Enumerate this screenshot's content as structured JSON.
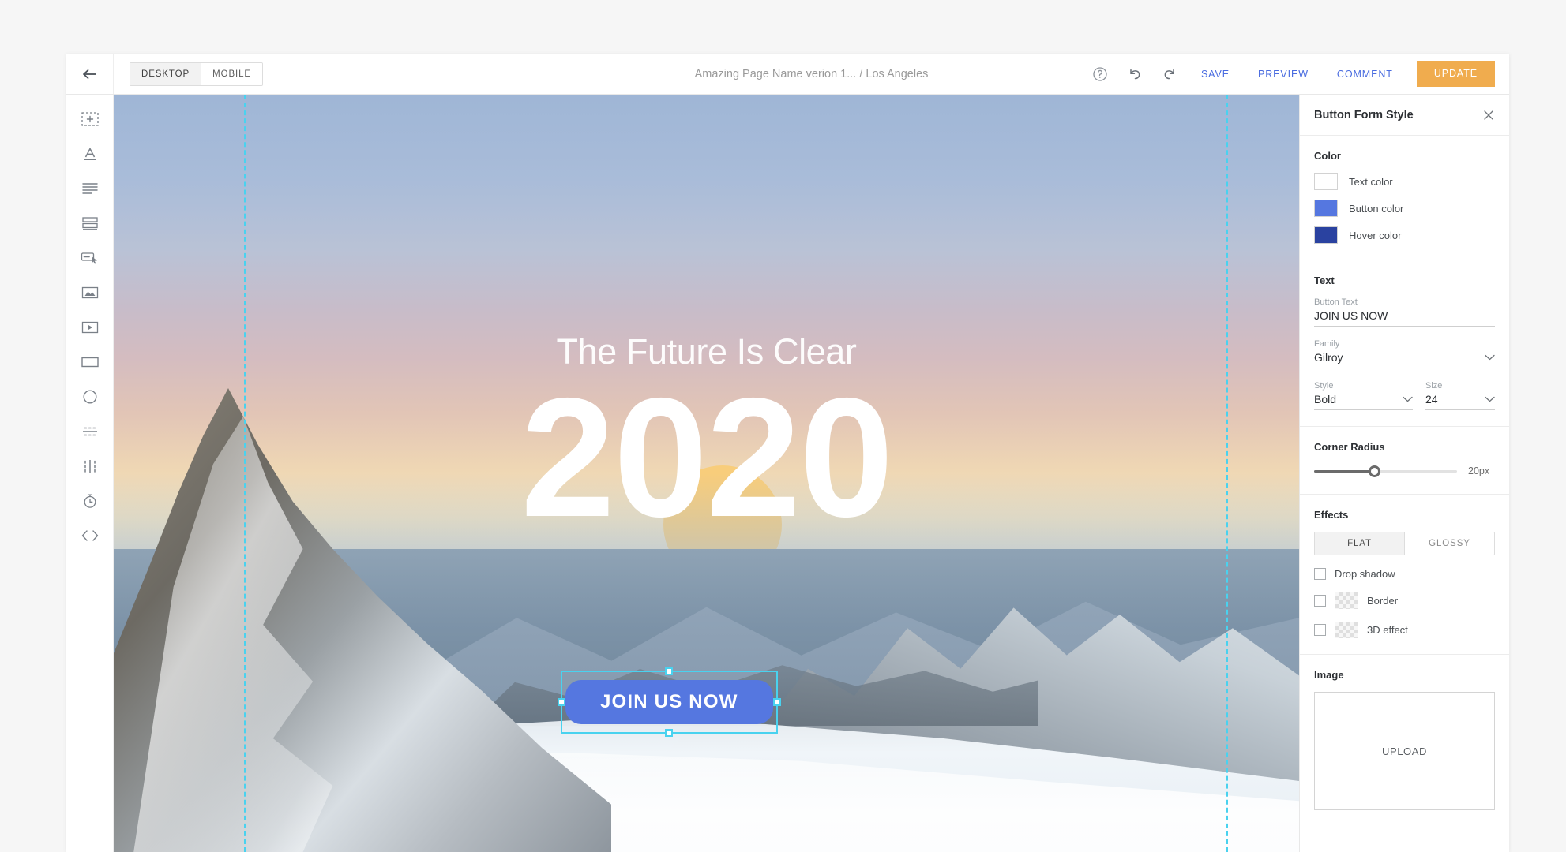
{
  "topbar": {
    "back_icon": "arrow-left-icon",
    "device_tabs": [
      {
        "label": "DESKTOP",
        "active": true
      },
      {
        "label": "MOBILE",
        "active": false
      }
    ],
    "page_title": "Amazing Page Name verion 1... / Los Angeles",
    "help_icon": "help-circle-icon",
    "undo_icon": "undo-icon",
    "redo_icon": "redo-icon",
    "save_label": "SAVE",
    "preview_label": "PREVIEW",
    "comment_label": "COMMENT",
    "update_label": "UPDATE",
    "link_color": "#4a6ce0",
    "update_color": "#f0ac4e"
  },
  "rail": {
    "items": [
      {
        "name": "add-section-icon"
      },
      {
        "name": "text-heading-icon"
      },
      {
        "name": "paragraph-icon"
      },
      {
        "name": "rows-icon"
      },
      {
        "name": "button-icon"
      },
      {
        "name": "image-icon"
      },
      {
        "name": "video-icon"
      },
      {
        "name": "rectangle-icon"
      },
      {
        "name": "circle-icon"
      },
      {
        "name": "horizontal-divider-icon"
      },
      {
        "name": "vertical-divider-icon"
      },
      {
        "name": "timer-icon"
      },
      {
        "name": "code-icon"
      }
    ]
  },
  "canvas": {
    "hero_subtitle": "The Future Is Clear",
    "hero_year": "2020",
    "cta_label": "JOIN US NOW",
    "cta_color": "#5577e0",
    "guide_color": "#49d2ef",
    "selection_color": "#49d2ef",
    "sun_color": "#f8cd7b"
  },
  "panel": {
    "title": "Button Form Style",
    "close_icon": "close-icon",
    "color_section": {
      "title": "Color",
      "swatches": [
        {
          "label": "Text color",
          "hex": "#ffffff"
        },
        {
          "label": "Button color",
          "hex": "#5577e0"
        },
        {
          "label": "Hover color",
          "hex": "#2a42a0"
        }
      ]
    },
    "text_section": {
      "title": "Text",
      "button_text_label": "Button Text",
      "button_text_value": "JOIN US NOW",
      "family_label": "Family",
      "family_value": "Gilroy",
      "style_label": "Style",
      "style_value": "Bold",
      "size_label": "Size",
      "size_value": "24"
    },
    "corner_section": {
      "title": "Corner Radius",
      "value": "20px",
      "percent": 42
    },
    "effects_section": {
      "title": "Effects",
      "tabs": [
        {
          "label": "FLAT",
          "active": true
        },
        {
          "label": "GLOSSY",
          "active": false
        }
      ],
      "checks": [
        {
          "label": "Drop shadow",
          "checked": false,
          "has_swatch": false
        },
        {
          "label": "Border",
          "checked": false,
          "has_swatch": true
        },
        {
          "label": "3D effect",
          "checked": false,
          "has_swatch": true
        }
      ]
    },
    "image_section": {
      "title": "Image",
      "upload_label": "UPLOAD"
    }
  }
}
